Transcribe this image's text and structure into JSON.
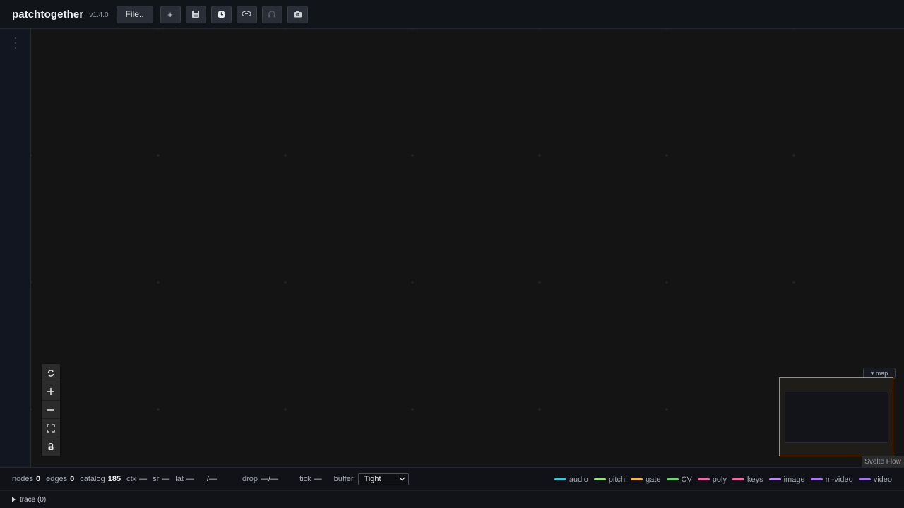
{
  "header": {
    "title": "patchtogether",
    "version": "v1.4.0",
    "file_label": "File..",
    "tools": [
      {
        "icon": "plus-icon",
        "glyph": "+"
      },
      {
        "icon": "save-icon"
      },
      {
        "icon": "history-icon"
      },
      {
        "icon": "link-icon"
      },
      {
        "icon": "headphones-icon"
      },
      {
        "icon": "camera-icon"
      }
    ]
  },
  "controls": [
    {
      "icon": "refresh-icon"
    },
    {
      "icon": "zoom-in-icon"
    },
    {
      "icon": "zoom-out-icon"
    },
    {
      "icon": "fit-view-icon"
    },
    {
      "icon": "lock-icon"
    }
  ],
  "minimap": {
    "toggle_label": "▾ map",
    "attribution": "Svelte Flow"
  },
  "status": {
    "nodes_label": "nodes",
    "nodes_value": "0",
    "edges_label": "edges",
    "edges_value": "0",
    "catalog_label": "catalog",
    "catalog_value": "185",
    "ctx_label": "ctx",
    "ctx_value": "—",
    "sr_label": "sr",
    "sr_value": "—",
    "lat_label": "lat",
    "lat_value": "—",
    "lat_extra": "/—",
    "drop_label": "drop",
    "drop_value": "—/—",
    "tick_label": "tick",
    "tick_value": "—",
    "buffer_label": "buffer",
    "buffer_value": "Tight"
  },
  "legend": [
    {
      "label": "audio",
      "color": "#3fc9d6"
    },
    {
      "label": "pitch",
      "color": "#9be07a"
    },
    {
      "label": "gate",
      "color": "#f5b74e"
    },
    {
      "label": "CV",
      "color": "#6bd66b"
    },
    {
      "label": "poly",
      "color": "#f06aa8"
    },
    {
      "label": "keys",
      "color": "#f26aa6"
    },
    {
      "label": "image",
      "color": "#b98cf2"
    },
    {
      "label": "m-video",
      "color": "#a878f0"
    },
    {
      "label": "video",
      "color": "#a374ee"
    }
  ],
  "trace": {
    "label": "trace (0)"
  }
}
